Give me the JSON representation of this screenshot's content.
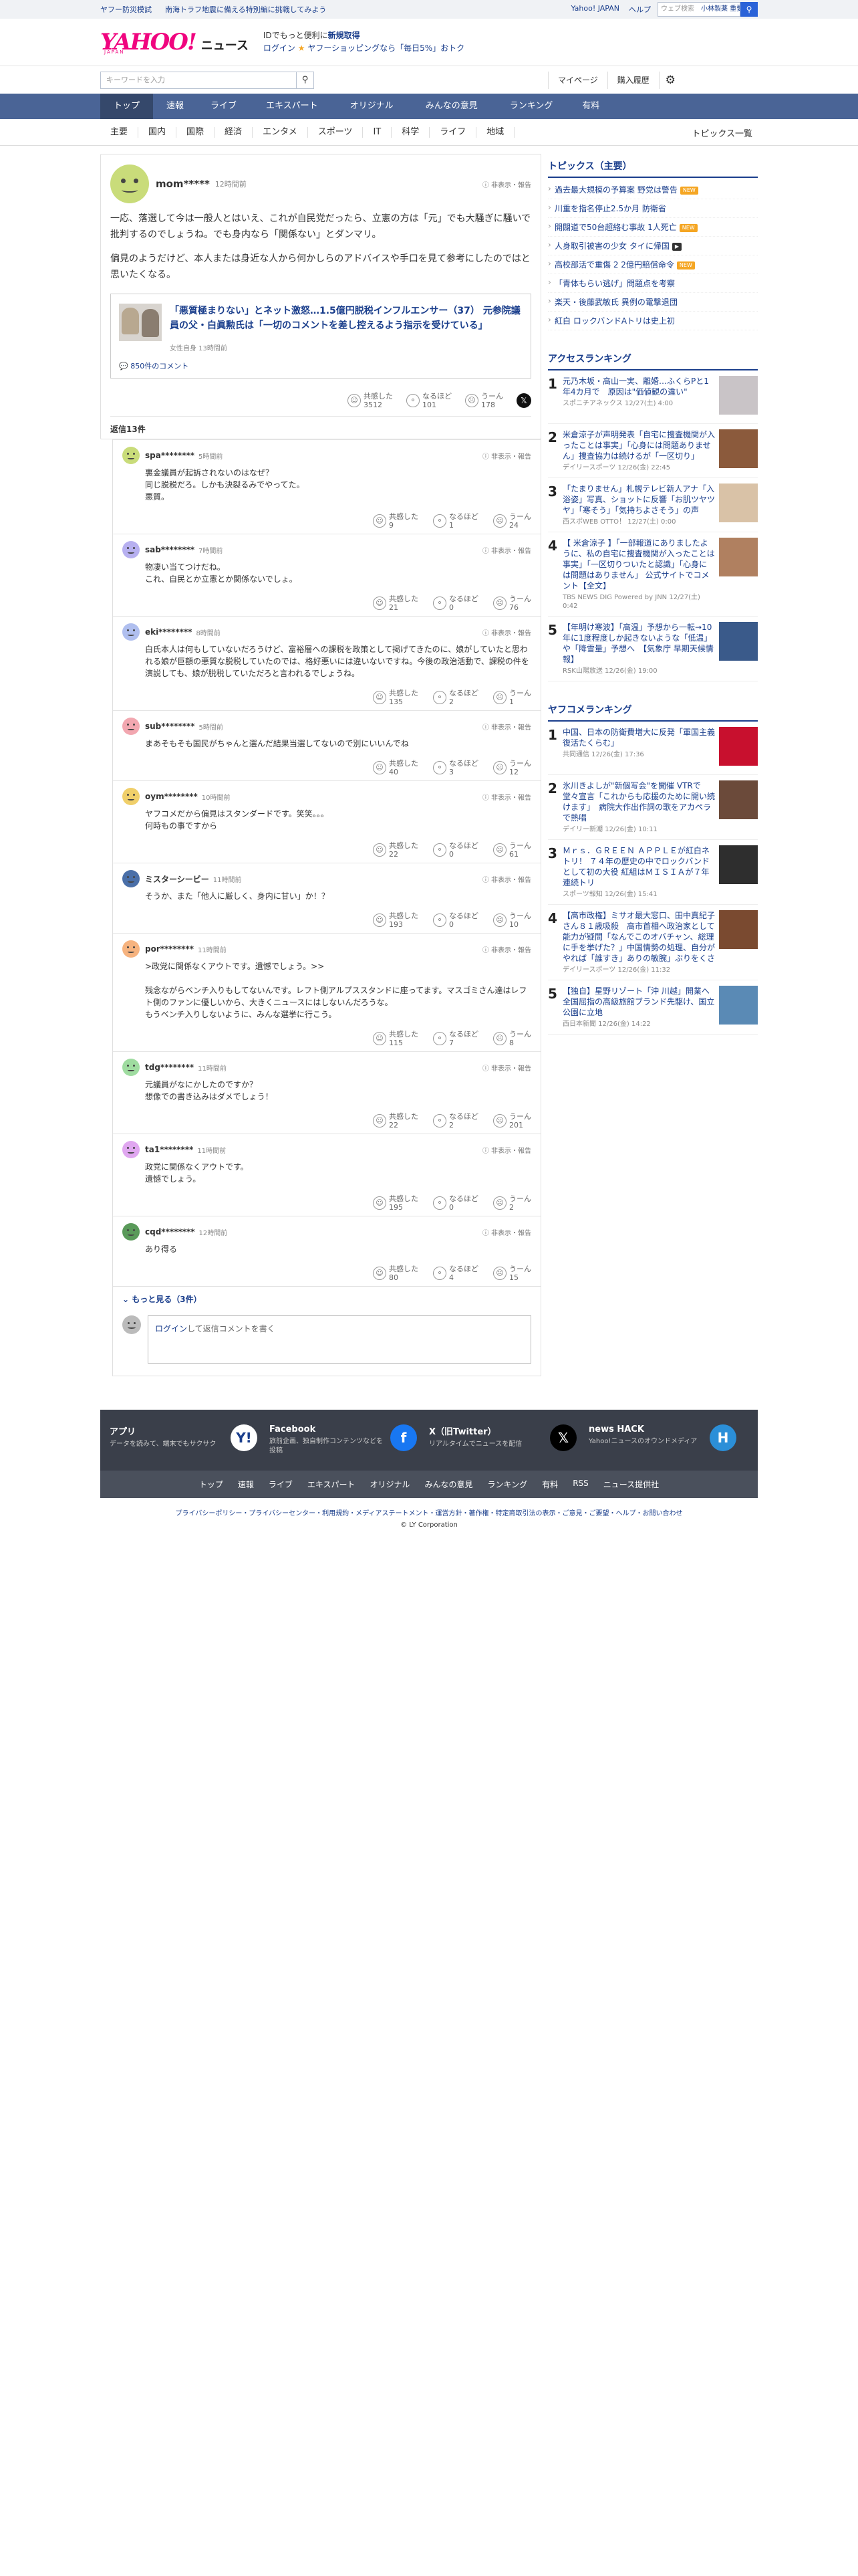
{
  "topstrip": {
    "promos": [
      "ヤフー防災模試",
      "南海トラフ地震に備える特別編に挑戦してみよう"
    ],
    "links": [
      "Yahoo! JAPAN",
      "ヘルプ"
    ],
    "search_placeholder": "ウェブ検索",
    "search_suggest": "小林製薬 重要…"
  },
  "header": {
    "logo": "YAHOO!",
    "logo_sub": "JAPAN",
    "service": "ニュース",
    "promo_line1_pre": "IDでもっと便利に",
    "promo_line1_link": "新規取得",
    "promo_line2_login": "ログイン",
    "promo_line2": "ヤフーショッピングなら「毎日5%」おトク"
  },
  "search": {
    "placeholder": "キーワードを入力",
    "mypage": "マイページ",
    "history": "購入履歴"
  },
  "nav": [
    "トップ",
    "速報",
    "ライブ",
    "エキスパート",
    "オリジナル",
    "みんなの意見",
    "ランキング",
    "有料"
  ],
  "subnav": [
    "主要",
    "国内",
    "国際",
    "経済",
    "エンタメ",
    "スポーツ",
    "IT",
    "科学",
    "ライフ",
    "地域"
  ],
  "subnav_right": "トピックス一覧",
  "post": {
    "user": "mom*****",
    "time": "12時間前",
    "report": "非表示・報告",
    "paragraphs": [
      "一応、落選して今は一般人とはいえ、これが自民党だったら、立憲の方は「元」でも大騒ぎに騒いで批判するのでしょうね。でも身内なら「関係ない」とダンマリ。",
      "偏見のようだけど、本人または身近な人から何かしらのアドバイスや手口を見て参考にしたのではと思いたくなる。"
    ],
    "article_title": "「悪質極まりない」とネット激怒…1.5億円脱税インフルエンサー（37） 元参院議員の父・白眞勲氏は「一切のコメントを差し控えるよう指示を受けている」",
    "article_source": "女性自身 13時間前",
    "article_comments": "850件のコメント",
    "reactions": {
      "agree_label": "共感した",
      "agree": "3512",
      "naruhodo_label": "なるほど",
      "naruhodo": "101",
      "uun_label": "うーん",
      "uun": "178"
    },
    "x_label": "𝕏"
  },
  "reply_count_pre": "返信",
  "reply_count": "13",
  "reply_count_post": "件",
  "replies": [
    {
      "user": "spa********",
      "time": "5時間前",
      "text": [
        "裏金議員が起訴されないのはなぜ？",
        "同じ脱税だろ。しかも決裂るみでやってた。",
        "悪質。"
      ],
      "agree": "9",
      "naruhodo": "1",
      "uun": "24"
    },
    {
      "user": "sab********",
      "time": "7時間前",
      "text": [
        "物凄い当てつけだね。",
        "これ、自民とか立憲とか関係ないでしょ。"
      ],
      "agree": "21",
      "naruhodo": "0",
      "uun": "76"
    },
    {
      "user": "eki********",
      "time": "8時間前",
      "text": [
        "白氏本人は何もしていないだろうけど、富裕層への課税を政策として掲げてきたのに、娘がしていたと思われる娘が巨額の悪質な脱税していたのでは、格好悪いには違いないですね。今後の政治活動で、課税の件を演説しても、娘が脱税していただろと言われるでしょうね。"
      ],
      "agree": "135",
      "naruhodo": "2",
      "uun": "1"
    },
    {
      "user": "sub********",
      "time": "5時間前",
      "text": [
        "まあそもそも国民がちゃんと選んだ結果当選してないので別にいいんでね"
      ],
      "agree": "40",
      "naruhodo": "3",
      "uun": "12"
    },
    {
      "user": "oym********",
      "time": "10時間前",
      "text": [
        "ヤフコメだから偏見はスタンダードです。笑笑。。。",
        "何時もの事ですから"
      ],
      "agree": "22",
      "naruhodo": "0",
      "uun": "61"
    },
    {
      "user": "ミスターシービー",
      "time": "11時間前",
      "text": [
        "そうか、また「他人に厳しく、身内に甘い」か！？"
      ],
      "agree": "193",
      "naruhodo": "0",
      "uun": "10"
    },
    {
      "user": "por********",
      "time": "11時間前",
      "text": [
        ">政党に関係なくアウトです。遺憾でしょう。>>",
        "",
        "残念ながらベンチ入りもしてないんです。レフト側アルプススタンドに座ってます。マスゴミさん達はレフト側のファンに優しいから、大きくニュースにはしないんだろうな。",
        "もうベンチ入りしないように、みんな選挙に行こう。"
      ],
      "agree": "115",
      "naruhodo": "7",
      "uun": "8"
    },
    {
      "user": "tdg********",
      "time": "11時間前",
      "text": [
        "元議員がなにかしたのですか？",
        "想像での書き込みはダメでしょう！"
      ],
      "agree": "22",
      "naruhodo": "2",
      "uun": "201"
    },
    {
      "user": "ta1********",
      "time": "11時間前",
      "text": [
        "政党に関係なくアウトです。",
        "遺憾でしょう。"
      ],
      "agree": "195",
      "naruhodo": "0",
      "uun": "2"
    },
    {
      "user": "cqd********",
      "time": "12時間前",
      "text": [
        "あり得る"
      ],
      "agree": "80",
      "naruhodo": "4",
      "uun": "15"
    }
  ],
  "more_label": "もっと見る（3件）",
  "reply_box": {
    "login": "ログイン",
    "text": "して返信コメントを書く"
  },
  "topics": {
    "title": "トピックス（主要）",
    "items": [
      {
        "t": "過去最大規模の予算案 野党は警告",
        "b": "new"
      },
      {
        "t": "川重を指名停止2.5か月 防衛省",
        "b": ""
      },
      {
        "t": "開闢道で50台超絡む事故 1人死亡",
        "b": "new"
      },
      {
        "t": "人身取引被害の少女 タイに帰国",
        "b": "cam"
      },
      {
        "t": "高校部活で重傷 2 2億円賠償命令",
        "b": "new"
      },
      {
        "t": "「青体もらい逃げ」問題点を考察",
        "b": ""
      },
      {
        "t": "楽天・後藤武敏氏 異例の電撃退団",
        "b": ""
      },
      {
        "t": "紅白 ロックバンドAトリは史上初",
        "b": ""
      }
    ]
  },
  "access": {
    "title": "アクセスランキング",
    "items": [
      {
        "n": "1",
        "t": "元乃木坂・高山一実、離婚…ふくらPと1年4カ月で　原因は\"価値観の違い\"",
        "s": "スポニチアネックス 12/27(土) 4:00",
        "c": "#c9c4c7"
      },
      {
        "n": "2",
        "t": "米倉涼子が声明発表「自宅に捜査機関が入ったことは事実」「心身には問題ありません」捜査協力は続けるが「一区切り」",
        "s": "デイリースポーツ 12/26(金) 22:45",
        "c": "#8b5a3c"
      },
      {
        "n": "3",
        "t": "「たまりません」札幌テレビ新人アナ「入浴姿」写真、ショットに反響「お肌ツヤツヤ」「寒そう」「気持ちよさそう」の声",
        "s": "西スポWEB OTTO！ 12/27(土) 0:00",
        "c": "#d9c2a7"
      },
      {
        "n": "4",
        "t": "【 米倉涼子 】「一部報道にありましたように、私の自宅に捜査機関が入ったことは事実」「一区切りついたと認識」「心身には問題はありません」 公式サイトでコメント【全文】",
        "s": "TBS NEWS DIG Powered by JNN 12/27(土) 0:42",
        "c": "#b08060"
      },
      {
        "n": "5",
        "t": "【年明け寒波】「高温」予想から一転→10年に1度程度しか起きないような「低温」や「降雪量」予想へ　【気象庁 早期天候情報】",
        "s": "RSK山陽放送 12/26(金) 19:00",
        "c": "#3a5a8a"
      }
    ]
  },
  "yafukome": {
    "title": "ヤフコメランキング",
    "items": [
      {
        "n": "1",
        "t": "中国、日本の防衛費増大に反発「軍国主義復活たくらむ」",
        "s": "共同通信 12/26(金) 17:36",
        "c": "#c8102e"
      },
      {
        "n": "2",
        "t": "氷川きよしが\"新個写会\"を開催 VTRで堂々宣言「これからも応援のために開い続けます」　病院大作出作詞の歌をアカペラで熱唱",
        "s": "デイリー新潮 12/26(金) 10:11",
        "c": "#6b4a3a"
      },
      {
        "n": "3",
        "t": "Ｍｒｓ．ＧＲＥＥＮ ＡＰＰＬＥが紅白ネトリ！ ７４年の歴史の中でロックバンドとして初の大役 紅組はＭＩＳＩＡが７年連続トリ",
        "s": "スポーツ報知 12/26(金) 15:41",
        "c": "#2e2e2e"
      },
      {
        "n": "4",
        "t": "【高市政権】ミサオ最大窓口、田中真紀子さん８１歳吸殺　高市首相へ政治家として能力が疑問「なんでこのオバチャン、総理に手を挙げた？」中国情勢の処理、自分がやれば「誰すき」ありの敏腕」ぶりをくさ",
        "s": "デイリースポーツ 12/26(金) 11:32",
        "c": "#7a4a30"
      },
      {
        "n": "5",
        "t": "【独自】星野リゾート「沖 川越」開業へ　全国屈指の高級旅館ブランド先駆け、国立公園に立地",
        "s": "西日本新聞 12/26(金) 14:22",
        "c": "#5a8ab5"
      }
    ]
  },
  "footer_apps": [
    {
      "h": "アプリ",
      "d": "データを読みて、端末でもサクサク",
      "ic": "Y!",
      "c": "#ffffff",
      "fg": "#1a3e8c"
    },
    {
      "h": "Facebook",
      "d": "旅前企画、独自制作コンテンツなどを投稿",
      "ic": "f",
      "c": "#1877f2",
      "fg": "#ffffff"
    },
    {
      "h": "X（旧Twitter）",
      "d": "リアルタイムでニュースを配信",
      "ic": "𝕏",
      "c": "#000000",
      "fg": "#ffffff"
    },
    {
      "h": "news HACK",
      "d": "Yahoo!ニュースのオウンドメディア",
      "ic": "H",
      "c": "#2b8fd8",
      "fg": "#ffffff"
    }
  ],
  "footer_links": [
    "トップ",
    "速報",
    "ライブ",
    "エキスパート",
    "オリジナル",
    "みんなの意見",
    "ランキング",
    "有料",
    "RSS",
    "ニュース提供社"
  ],
  "legal": "プライバシーポリシー・プライバシーセンター・利用規約・メディアステートメント・運営方針・著作権・特定商取引法の表示・ご意見・ご要望・ヘルプ・お問い合わせ",
  "copyright": "© LY Corporation",
  "colors": {
    "brand": "#f0047f",
    "nav": "#4a6496",
    "link": "#1a3e8c"
  }
}
